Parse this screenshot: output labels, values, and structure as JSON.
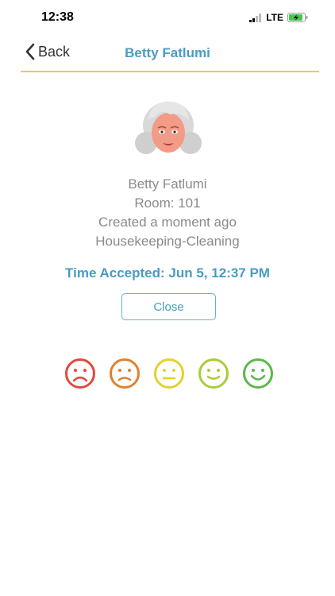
{
  "status_bar": {
    "time": "12:38",
    "network": "LTE"
  },
  "nav": {
    "back_label": "Back",
    "title": "Betty Fatlumi"
  },
  "details": {
    "name": "Betty Fatlumi",
    "room": "Room: 101",
    "created": "Created a moment ago",
    "category": "Housekeeping-Cleaning"
  },
  "time_accepted": "Time Accepted: Jun 5, 12:37 PM",
  "close_label": "Close",
  "ratings": [
    {
      "icon": "very-sad-face-icon",
      "color": "#e04a3c"
    },
    {
      "icon": "sad-face-icon",
      "color": "#e0812e"
    },
    {
      "icon": "neutral-face-icon",
      "color": "#e6cf2e"
    },
    {
      "icon": "smile-face-icon",
      "color": "#a9cc3a"
    },
    {
      "icon": "happy-face-icon",
      "color": "#5bb84a"
    }
  ],
  "colors": {
    "accent": "#4a9bc4",
    "divider": "#f2cf2f"
  }
}
